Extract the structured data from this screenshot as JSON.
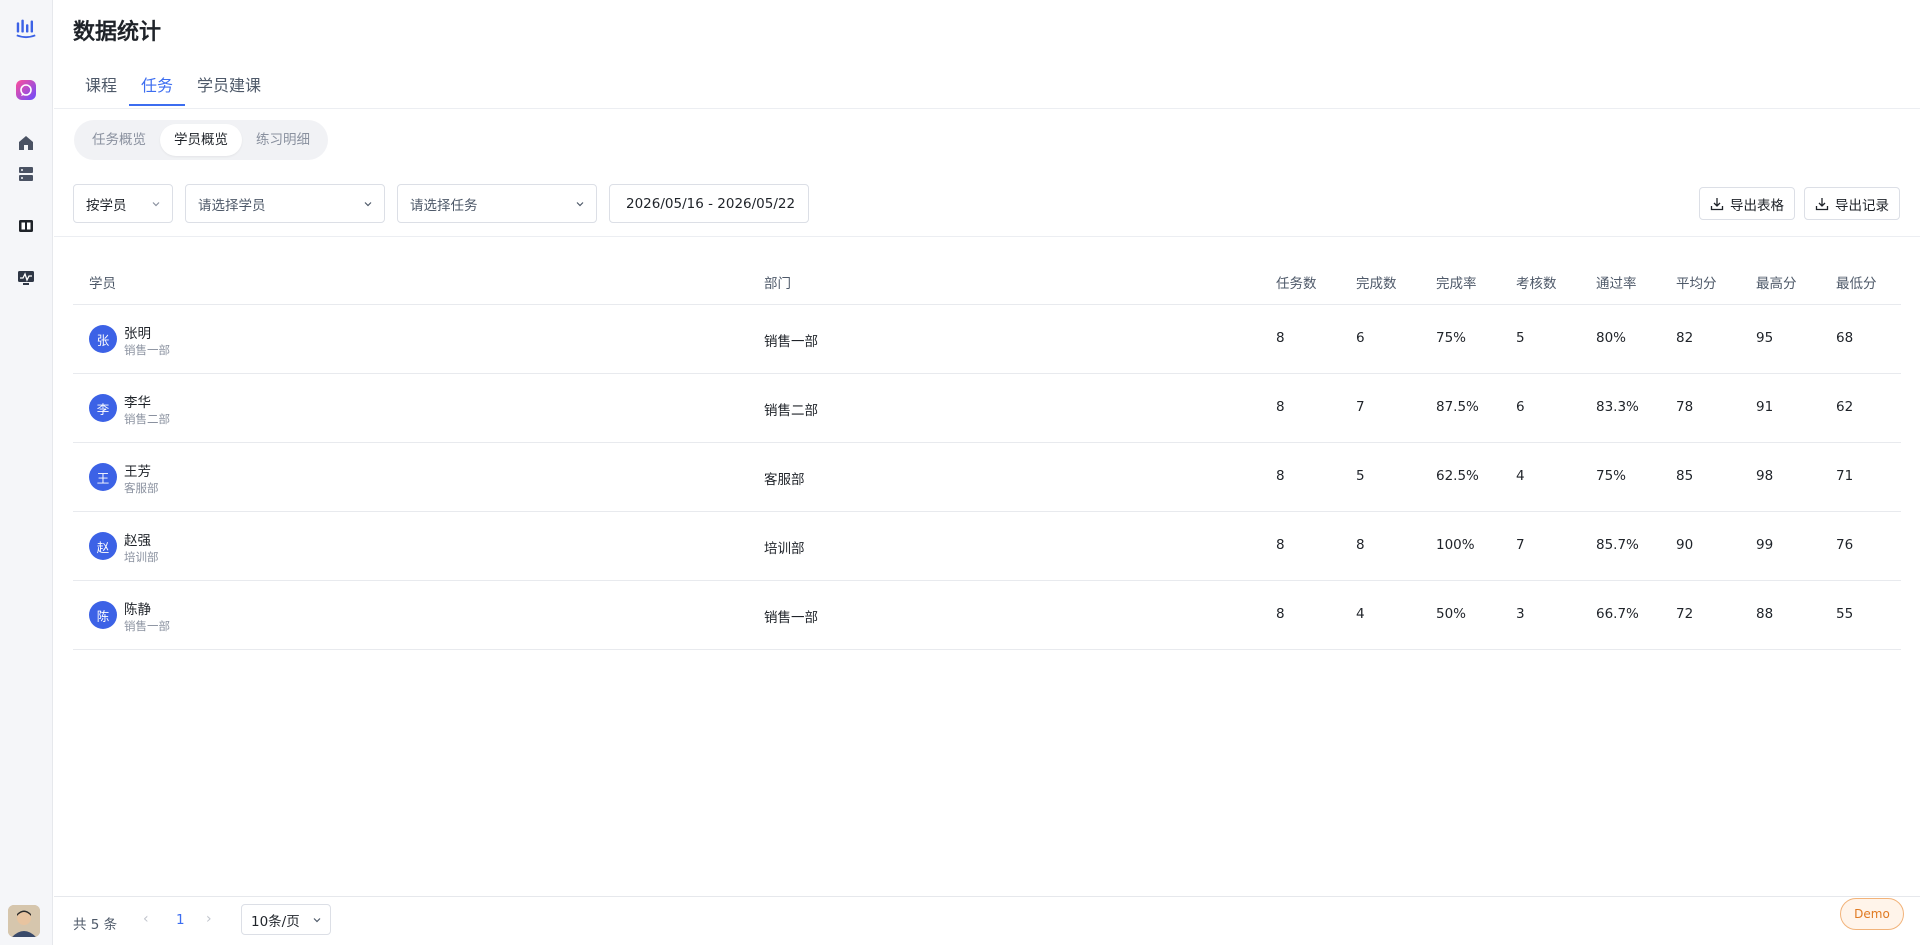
{
  "page": {
    "title": "数据统计"
  },
  "sidebar": {
    "icons": [
      "chart-logo-icon",
      "chat-bubble-icon",
      "home-icon",
      "server-icon",
      "book-icon",
      "monitor-icon"
    ],
    "accent": "#3c62e6"
  },
  "tabs": [
    {
      "label": "课程",
      "active": false
    },
    {
      "label": "任务",
      "active": true
    },
    {
      "label": "学员建课",
      "active": false
    }
  ],
  "subtabs": [
    {
      "label": "任务概览",
      "active": false
    },
    {
      "label": "学员概览",
      "active": true
    },
    {
      "label": "练习明细",
      "active": false
    }
  ],
  "filters": {
    "mode": "按学员",
    "student_placeholder": "请选择学员",
    "task_placeholder": "请选择任务",
    "date_range": "2026/05/16 - 2026/05/22"
  },
  "actions": {
    "export_table": "导出表格",
    "export_records": "导出记录"
  },
  "table": {
    "headers": {
      "student": "学员",
      "dept": "部门",
      "tasks": "任务数",
      "done": "完成数",
      "rate": "完成率",
      "exams": "考核数",
      "pass": "通过率",
      "avg": "平均分",
      "max": "最高分",
      "min": "最低分"
    },
    "rows": [
      {
        "avatar": "张",
        "name": "张明",
        "sub": "销售一部",
        "dept": "销售一部",
        "tasks": "8",
        "done": "6",
        "rate": "75%",
        "exams": "5",
        "pass": "80%",
        "avg": "82",
        "max": "95",
        "min": "68"
      },
      {
        "avatar": "李",
        "name": "李华",
        "sub": "销售二部",
        "dept": "销售二部",
        "tasks": "8",
        "done": "7",
        "rate": "87.5%",
        "exams": "6",
        "pass": "83.3%",
        "avg": "78",
        "max": "91",
        "min": "62"
      },
      {
        "avatar": "王",
        "name": "王芳",
        "sub": "客服部",
        "dept": "客服部",
        "tasks": "8",
        "done": "5",
        "rate": "62.5%",
        "exams": "4",
        "pass": "75%",
        "avg": "85",
        "max": "98",
        "min": "71"
      },
      {
        "avatar": "赵",
        "name": "赵强",
        "sub": "培训部",
        "dept": "培训部",
        "tasks": "8",
        "done": "8",
        "rate": "100%",
        "exams": "7",
        "pass": "85.7%",
        "avg": "90",
        "max": "99",
        "min": "76"
      },
      {
        "avatar": "陈",
        "name": "陈静",
        "sub": "销售一部",
        "dept": "销售一部",
        "tasks": "8",
        "done": "4",
        "rate": "50%",
        "exams": "3",
        "pass": "66.7%",
        "avg": "72",
        "max": "88",
        "min": "55"
      }
    ]
  },
  "pagination": {
    "total": "共 5 条",
    "current": "1",
    "page_size": "10条/页"
  },
  "badge": {
    "demo": "Demo"
  }
}
